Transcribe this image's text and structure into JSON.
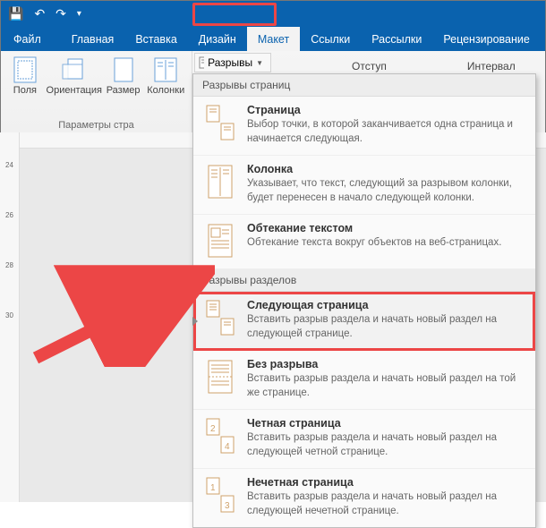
{
  "qat": {
    "save": "💾",
    "undo": "↶",
    "redo": "↷",
    "more": "▾"
  },
  "tabs": {
    "file": "Файл",
    "home": "Главная",
    "insert": "Вставка",
    "design": "Дизайн",
    "layout": "Макет",
    "references": "Ссылки",
    "mailings": "Рассылки",
    "review": "Рецензирование"
  },
  "ribbon": {
    "margins": "Поля",
    "orientation": "Ориентация",
    "size": "Размер",
    "columns": "Колонки",
    "group_page_setup": "Параметры стра",
    "breaks_label": "Разрывы",
    "indent": "Отступ",
    "spacing": "Интервал"
  },
  "dropdown": {
    "section1": "Разрывы страниц",
    "items1": [
      {
        "title": "Страница",
        "desc": "Выбор точки, в которой заканчивается одна страница и начинается следующая."
      },
      {
        "title": "Колонка",
        "desc": "Указывает, что текст, следующий за разрывом колонки, будет перенесен в начало следующей колонки."
      },
      {
        "title": "Обтекание текстом",
        "desc": "Обтекание текста вокруг объектов на веб-страницах."
      }
    ],
    "section2": "Разрывы разделов",
    "items2": [
      {
        "title": "Следующая страница",
        "desc": "Вставить разрыв раздела и начать новый раздел на следующей странице."
      },
      {
        "title": "Без разрыва",
        "desc": "Вставить разрыв раздела и начать новый раздел на той же странице."
      },
      {
        "title": "Четная страница",
        "desc": "Вставить разрыв раздела и начать новый раздел на следующей четной странице."
      },
      {
        "title": "Нечетная страница",
        "desc": "Вставить разрыв раздела и начать новый раздел на следующей нечетной странице."
      }
    ]
  },
  "ruler": {
    "corner": "L",
    "ticks": [
      "24",
      "",
      "26",
      "",
      "28",
      "",
      "30"
    ]
  }
}
